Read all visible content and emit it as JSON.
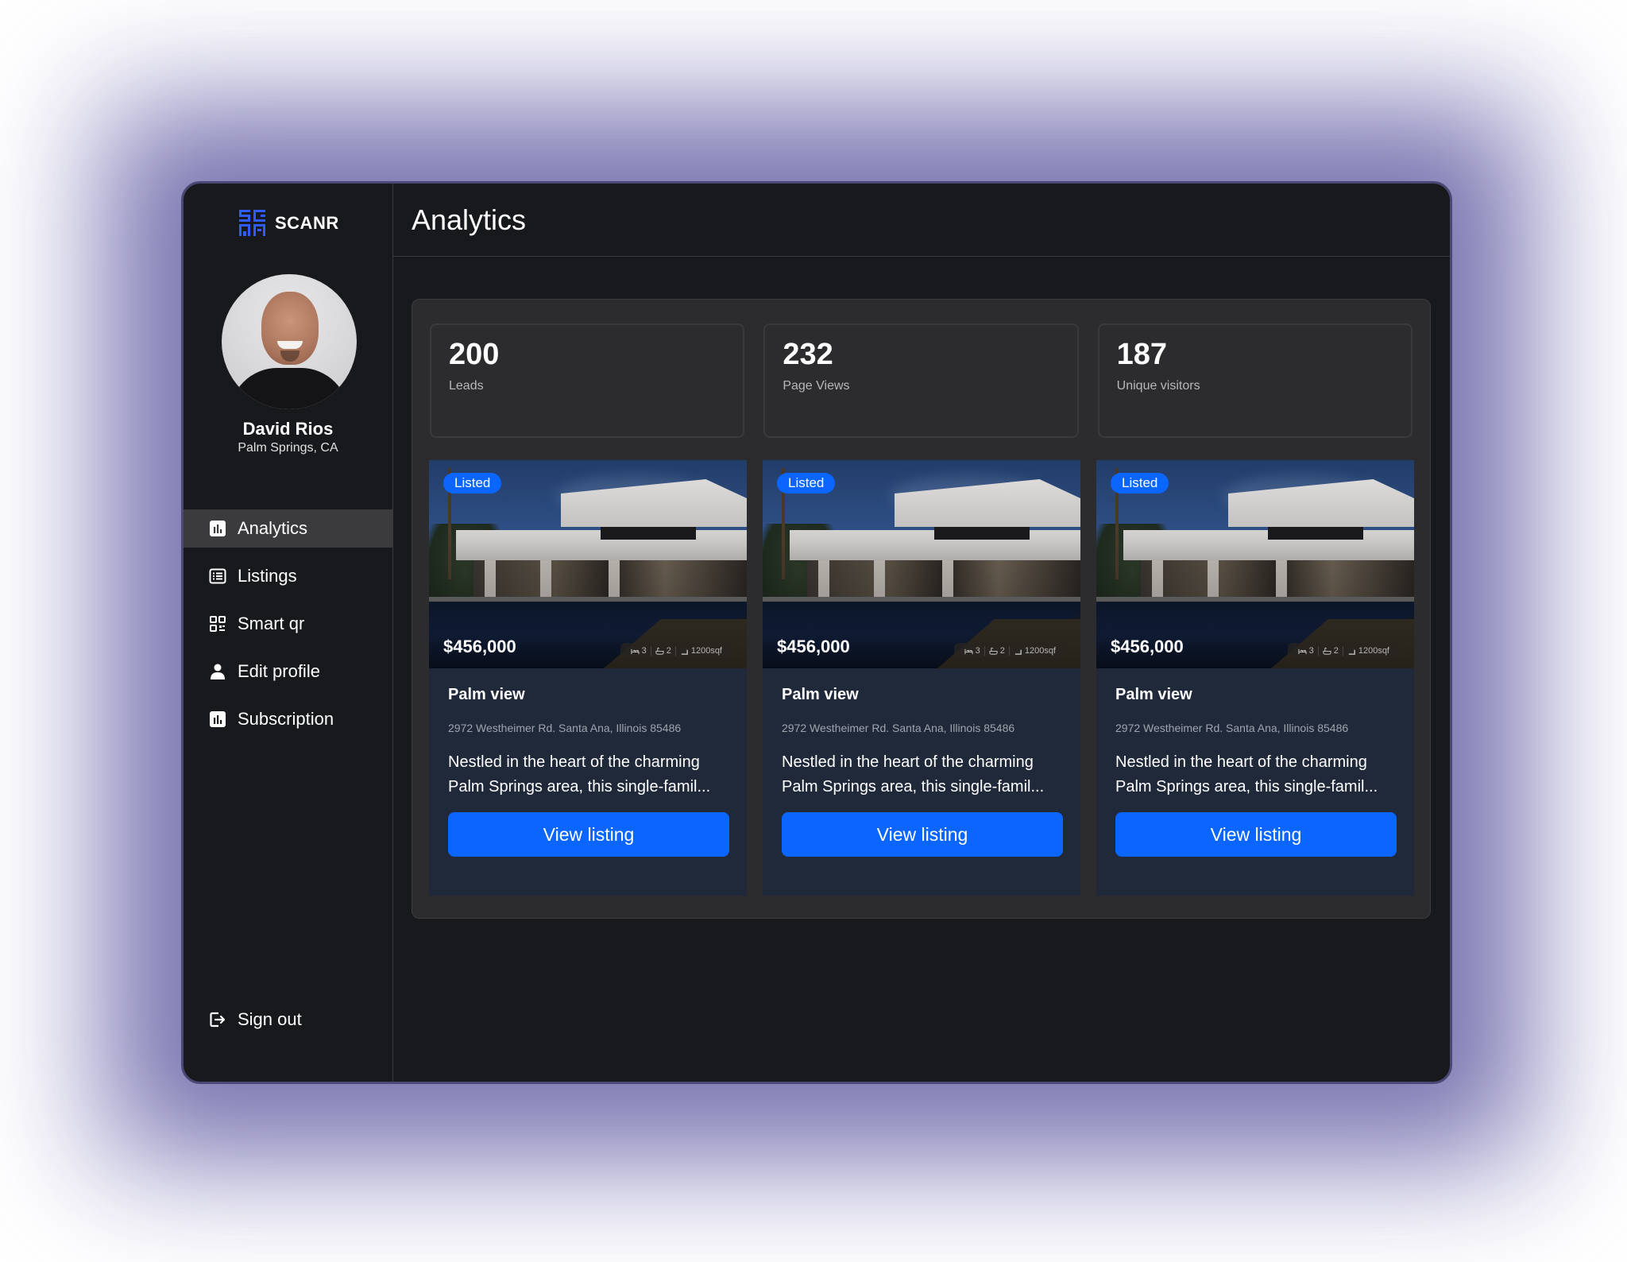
{
  "brand": {
    "name": "SCANR",
    "accent": "#2f5bff"
  },
  "profile": {
    "name": "David Rios",
    "location": "Palm Springs, CA"
  },
  "sidebar": {
    "items": [
      {
        "label": "Analytics",
        "icon": "bar-chart-icon",
        "active": true
      },
      {
        "label": "Listings",
        "icon": "list-icon",
        "active": false
      },
      {
        "label": "Smart qr",
        "icon": "qr-code-icon",
        "active": false
      },
      {
        "label": "Edit profile",
        "icon": "user-icon",
        "active": false
      },
      {
        "label": "Subscription",
        "icon": "bar-chart-icon",
        "active": false
      }
    ],
    "signout": {
      "label": "Sign out",
      "icon": "sign-out-icon"
    }
  },
  "header": {
    "title": "Analytics"
  },
  "stats": [
    {
      "value": "200",
      "label": "Leads"
    },
    {
      "value": "232",
      "label": "Page Views"
    },
    {
      "value": "187",
      "label": "Unique visitors"
    }
  ],
  "listings": [
    {
      "badge": "Listed",
      "price": "$456,000",
      "beds": "3",
      "baths": "2",
      "area": "1200sqf",
      "title": "Palm view",
      "address": "2972 Westheimer Rd. Santa Ana, Illinois 85486",
      "description": "Nestled in the heart of the charming Palm Springs area, this single-famil...",
      "button": "View listing"
    },
    {
      "badge": "Listed",
      "price": "$456,000",
      "beds": "3",
      "baths": "2",
      "area": "1200sqf",
      "title": "Palm view",
      "address": "2972 Westheimer Rd. Santa Ana, Illinois 85486",
      "description": "Nestled in the heart of the charming Palm Springs area, this single-famil...",
      "button": "View listing"
    },
    {
      "badge": "Listed",
      "price": "$456,000",
      "beds": "3",
      "baths": "2",
      "area": "1200sqf",
      "title": "Palm view",
      "address": "2972 Westheimer Rd. Santa Ana, Illinois 85486",
      "description": "Nestled in the heart of the charming Palm Springs area, this single-famil...",
      "button": "View listing"
    }
  ],
  "colors": {
    "primary_button": "#0a66ff",
    "background": "#18191d",
    "panel": "#2c2c2e",
    "card": "#20293a"
  }
}
